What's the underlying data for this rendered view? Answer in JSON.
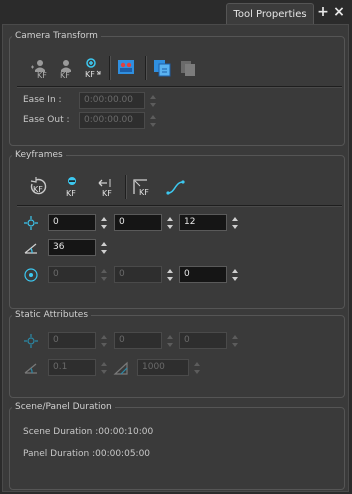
{
  "tab": {
    "title": "Tool Properties",
    "add_label": "+",
    "close_label": "×"
  },
  "camera_transform": {
    "title": "Camera Transform",
    "ease_in_label": "Ease In :",
    "ease_in_value": "0:00:00.00",
    "ease_out_label": "Ease Out :",
    "ease_out_value": "0:00:00.00",
    "tools": [
      "set-keyframe-icon",
      "camera-keyframe-icon",
      "add-keyframe-icon",
      "camera-group-icon",
      "copy-layers-icon",
      "layers-icon"
    ]
  },
  "keyframes": {
    "title": "Keyframes",
    "tools": [
      "reset-keyframe-icon",
      "remove-keyframe-icon",
      "previous-keyframe-icon",
      "keyframe-frame-icon",
      "ease-curve-icon"
    ],
    "position": {
      "x": "0",
      "y": "0",
      "z": "12"
    },
    "angle": "36",
    "pivot": {
      "x": "0",
      "y": "0",
      "z": "0"
    }
  },
  "static_attributes": {
    "title": "Static Attributes",
    "position": {
      "x": "0",
      "y": "0",
      "z": "0"
    },
    "angle": "0.1",
    "scale": "1000"
  },
  "scene_panel_duration": {
    "title": "Scene/Panel Duration",
    "scene_duration": "Scene Duration :00:00:10:00",
    "panel_duration": "Panel Duration :00:00:05:00"
  },
  "colors": {
    "panel_bg": "#3a3a3a",
    "field_bg": "#151515",
    "accent_cyan": "#3cc8f0",
    "accent_blue": "#2f8fe0"
  }
}
